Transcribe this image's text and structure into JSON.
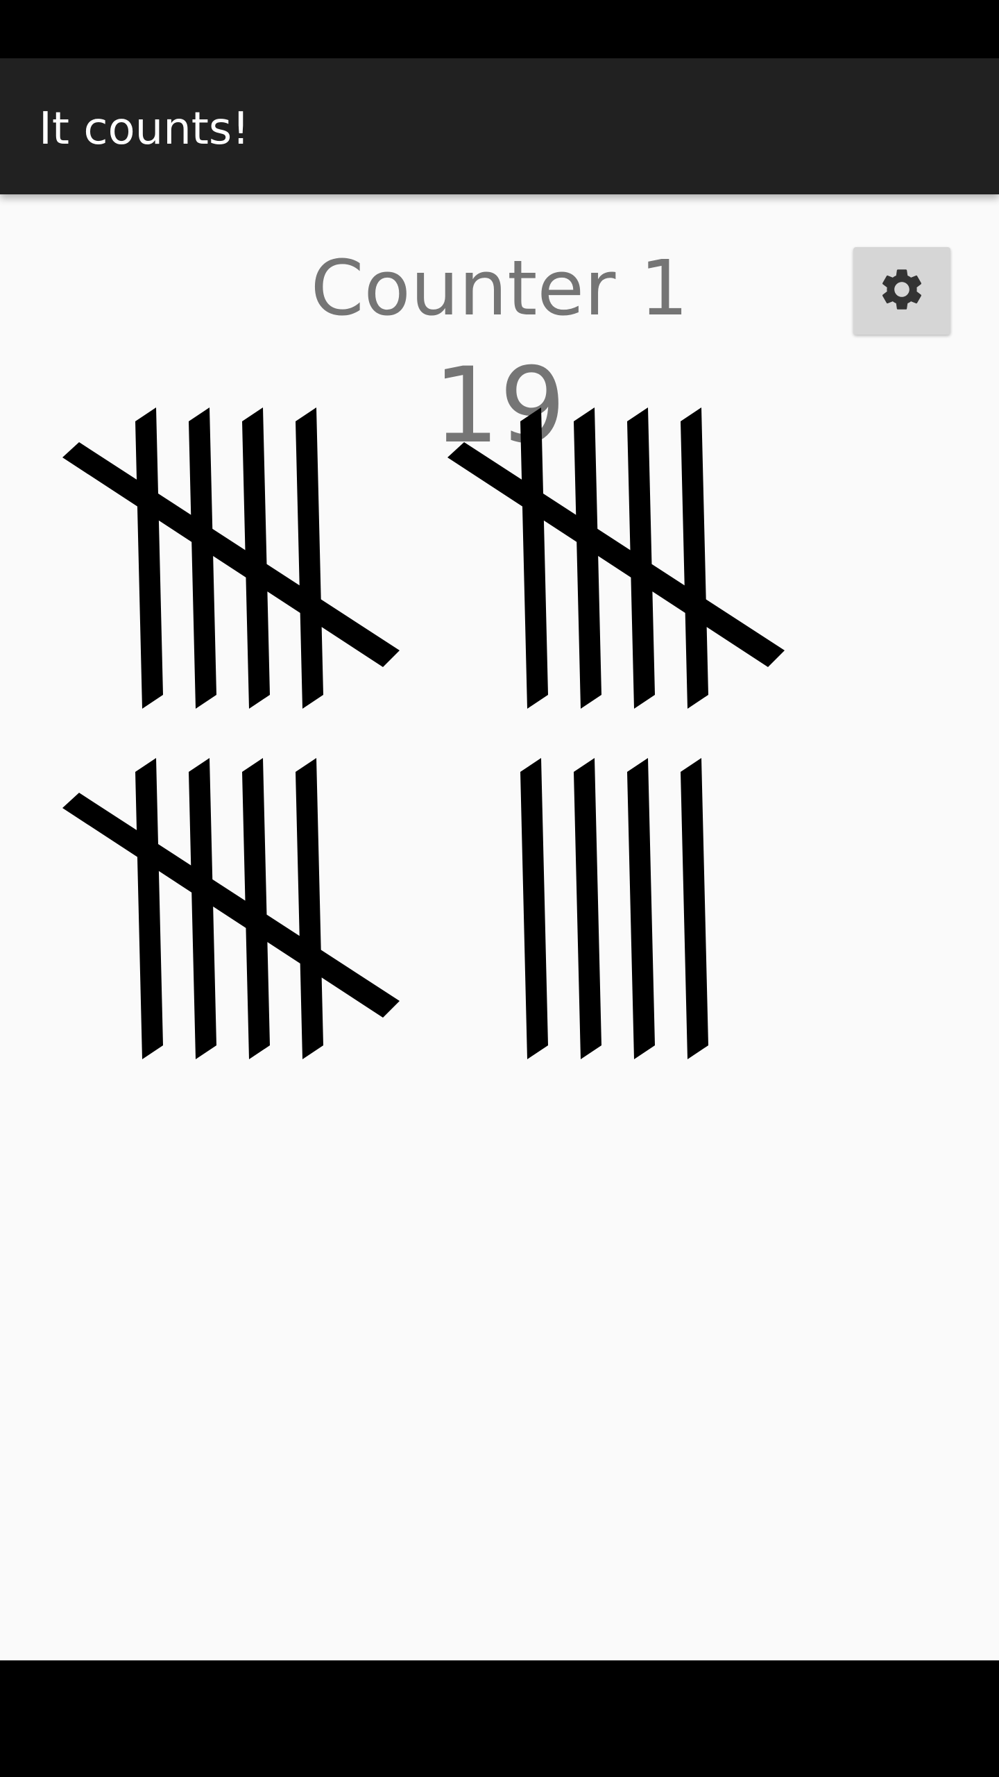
{
  "app": {
    "title": "It counts!"
  },
  "counter": {
    "name": "Counter 1",
    "count": "19",
    "count_value": 19
  },
  "settings_button": {
    "icon": "gear-icon"
  },
  "tally_groups": [
    {
      "marks": 5
    },
    {
      "marks": 5
    },
    {
      "marks": 5
    },
    {
      "marks": 4
    }
  ],
  "colors": {
    "app_bar": "#212121",
    "background": "#fafafa",
    "counter_text": "#757575",
    "tally_marks": "#000000",
    "settings_button_bg": "#d6d6d6",
    "gear": "#333333"
  }
}
